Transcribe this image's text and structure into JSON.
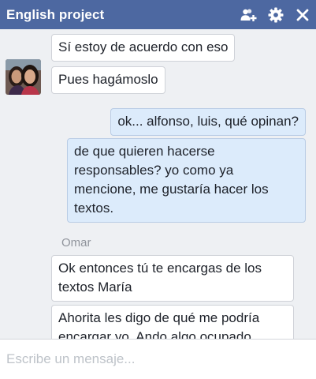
{
  "chat": {
    "title": "English project",
    "actions": {
      "add_people": "add-people-icon",
      "settings": "gear-icon",
      "close": "close-icon"
    }
  },
  "messages": [
    {
      "direction": "in",
      "text": "Sí estoy de acuerdo con eso"
    },
    {
      "direction": "in",
      "text": "Pues hagámoslo"
    },
    {
      "direction": "out",
      "text": "ok... alfonso, luis, qué opinan?"
    },
    {
      "direction": "out",
      "text": "de que quieren hacerse responsables? yo como ya mencione, me gustaría hacer los textos."
    },
    {
      "direction": "in",
      "sender": "Omar",
      "text": "Ok entonces tú te encargas de los textos María"
    },
    {
      "direction": "in",
      "text": "Ahorita les digo de qué me podría encargar yo. Ando algo ocupado"
    }
  ],
  "composer": {
    "placeholder": "Escribe un mensaje..."
  },
  "colors": {
    "titlebar": "#4d68a1",
    "background": "#eef0f3",
    "outgoing_bubble": "#dcebfb",
    "incoming_bubble": "#ffffff"
  }
}
